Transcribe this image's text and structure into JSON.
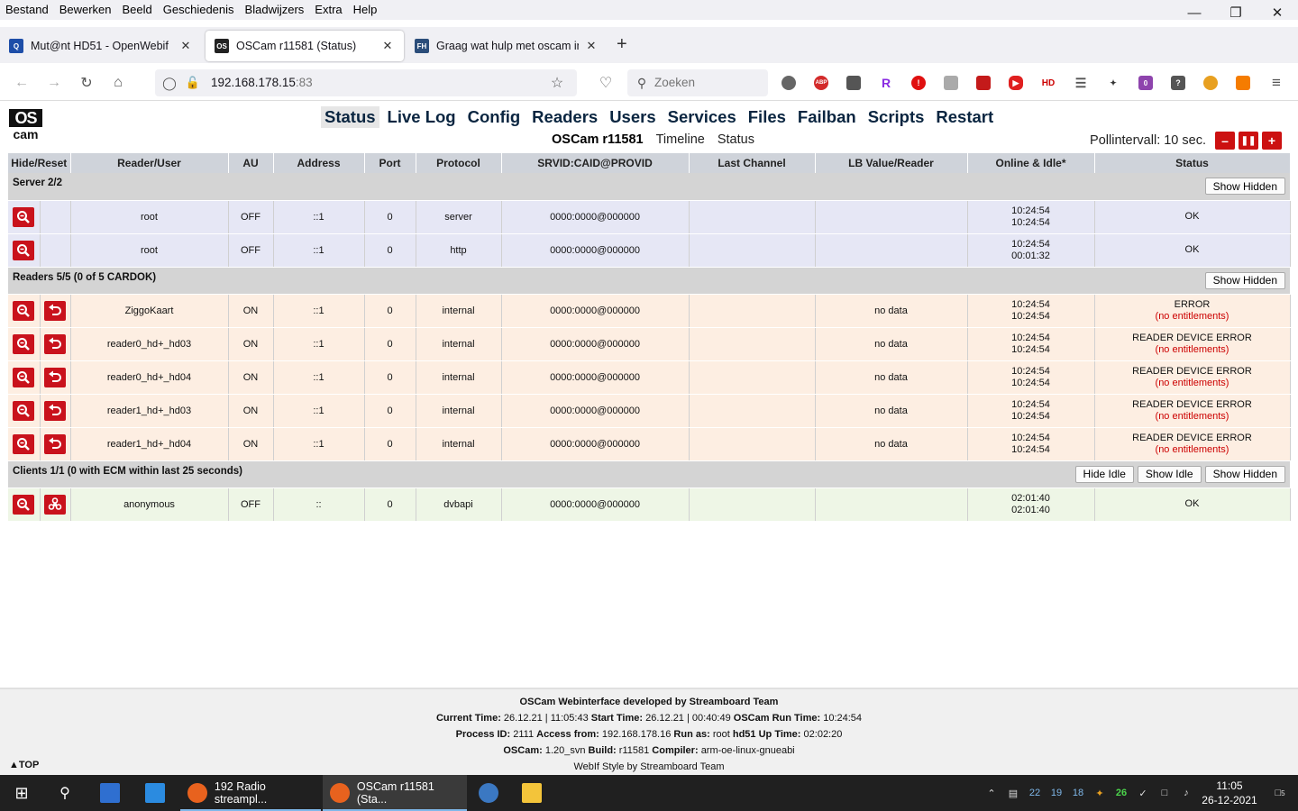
{
  "menubar": {
    "items": [
      "Bestand",
      "Bewerken",
      "Beeld",
      "Geschiedenis",
      "Bladwijzers",
      "Extra",
      "Help"
    ]
  },
  "tabs": [
    {
      "title": "Mut@nt HD51 - OpenWebif",
      "active": false
    },
    {
      "title": "OSCam r11581 (Status)",
      "active": true
    },
    {
      "title": "Graag wat hulp met oscam inst",
      "active": false
    }
  ],
  "nav": {
    "url_host": "192.168.178.15",
    "url_port": ":83",
    "search_placeholder": "Zoeken"
  },
  "extensions": {
    "badge": "0"
  },
  "oscam": {
    "logo_top": "OS",
    "logo_bottom": "cam",
    "menu": [
      "Status",
      "Live Log",
      "Config",
      "Readers",
      "Users",
      "Services",
      "Files",
      "Failban",
      "Scripts",
      "Restart"
    ],
    "active_menu": "Status",
    "sub_brand": "OSCam r11581",
    "sub_links": [
      "Timeline",
      "Status"
    ],
    "poll_label": "Pollintervall: 10 sec.",
    "poll_buttons": [
      "–",
      "❚❚",
      "+"
    ],
    "columns": [
      "Hide/Reset",
      "Reader/User",
      "AU",
      "Address",
      "Port",
      "Protocol",
      "SRVID:CAID@PROVID",
      "Last Channel",
      "LB Value/Reader",
      "Online & Idle*",
      "Status"
    ],
    "server_section": {
      "label": "Server 2/2",
      "buttons": [
        "Show Hidden"
      ],
      "rows": [
        {
          "name": "root",
          "au": "OFF",
          "address": "::1",
          "port": "0",
          "protocol": "server",
          "srvid": "0000:0000@000000",
          "last_channel": "",
          "lb": "",
          "online": "10:24:54",
          "idle": "10:24:54",
          "status": "OK",
          "status_note": ""
        },
        {
          "name": "root",
          "au": "OFF",
          "address": "::1",
          "port": "0",
          "protocol": "http",
          "srvid": "0000:0000@000000",
          "last_channel": "",
          "lb": "",
          "online": "10:24:54",
          "idle": "00:01:32",
          "status": "OK",
          "status_note": ""
        }
      ]
    },
    "reader_section": {
      "label": "Readers 5/5 (0 of 5 CARDOK)",
      "buttons": [
        "Show Hidden"
      ],
      "rows": [
        {
          "name": "ZiggoKaart",
          "au": "ON",
          "address": "::1",
          "port": "0",
          "protocol": "internal",
          "srvid": "0000:0000@000000",
          "last_channel": "",
          "lb": "no data",
          "online": "10:24:54",
          "idle": "10:24:54",
          "status": "ERROR",
          "status_note": "(no entitlements)"
        },
        {
          "name": "reader0_hd+_hd03",
          "au": "ON",
          "address": "::1",
          "port": "0",
          "protocol": "internal",
          "srvid": "0000:0000@000000",
          "last_channel": "",
          "lb": "no data",
          "online": "10:24:54",
          "idle": "10:24:54",
          "status": "READER DEVICE ERROR",
          "status_note": "(no entitlements)"
        },
        {
          "name": "reader0_hd+_hd04",
          "au": "ON",
          "address": "::1",
          "port": "0",
          "protocol": "internal",
          "srvid": "0000:0000@000000",
          "last_channel": "",
          "lb": "no data",
          "online": "10:24:54",
          "idle": "10:24:54",
          "status": "READER DEVICE ERROR",
          "status_note": "(no entitlements)"
        },
        {
          "name": "reader1_hd+_hd03",
          "au": "ON",
          "address": "::1",
          "port": "0",
          "protocol": "internal",
          "srvid": "0000:0000@000000",
          "last_channel": "",
          "lb": "no data",
          "online": "10:24:54",
          "idle": "10:24:54",
          "status": "READER DEVICE ERROR",
          "status_note": "(no entitlements)"
        },
        {
          "name": "reader1_hd+_hd04",
          "au": "ON",
          "address": "::1",
          "port": "0",
          "protocol": "internal",
          "srvid": "0000:0000@000000",
          "last_channel": "",
          "lb": "no data",
          "online": "10:24:54",
          "idle": "10:24:54",
          "status": "READER DEVICE ERROR",
          "status_note": "(no entitlements)"
        }
      ]
    },
    "client_section": {
      "label": "Clients 1/1 (0 with ECM within last 25 seconds)",
      "buttons": [
        "Hide Idle",
        "Show Idle",
        "Show Hidden"
      ],
      "rows": [
        {
          "name": "anonymous",
          "au": "OFF",
          "address": "::",
          "port": "0",
          "protocol": "dvbapi",
          "srvid": "0000:0000@000000",
          "last_channel": "",
          "lb": "",
          "online": "02:01:40",
          "idle": "02:01:40",
          "status": "OK",
          "status_note": ""
        }
      ]
    }
  },
  "footer": {
    "line1": "OSCam Webinterface developed by Streamboard Team",
    "current_time_label": "Current Time:",
    "current_time": "26.12.21 | 11:05:43",
    "start_time_label": "Start Time:",
    "start_time": "26.12.21 | 00:40:49",
    "run_time_label": "OSCam Run Time:",
    "run_time": "10:24:54",
    "pid_label": "Process ID:",
    "pid": "2111",
    "access_label": "Access from:",
    "access": "192.168.178.16",
    "run_as_label": "Run as:",
    "run_as": "root",
    "host": "hd51",
    "uptime_label": "Up Time:",
    "uptime": "02:02:20",
    "oscam_label": "OSCam:",
    "oscam_ver": "1.20_svn",
    "build_label": "Build:",
    "build": "r11581",
    "compiler_label": "Compiler:",
    "compiler": "arm-oe-linux-gnueabi",
    "style_line": "WebIf Style by Streamboard Team",
    "top_link": "▲TOP"
  },
  "taskbar": {
    "apps": [
      {
        "title": "192 Radio streampl...",
        "active": false
      },
      {
        "title": "OSCam r11581 (Sta...",
        "active": true
      }
    ],
    "tray_numbers": [
      "22",
      "19",
      "18",
      "26"
    ],
    "notif_count": "5",
    "clock_time": "11:05",
    "clock_date": "26-12-2021"
  },
  "colors": {
    "accent_red": "#cc1111",
    "server_row": "#e6e7f5",
    "reader_row": "#fdeee2",
    "client_row": "#eef6e6",
    "header_bg": "#cfd3da",
    "section_bg": "#d4d4d4",
    "error_text": "#cc0000"
  }
}
